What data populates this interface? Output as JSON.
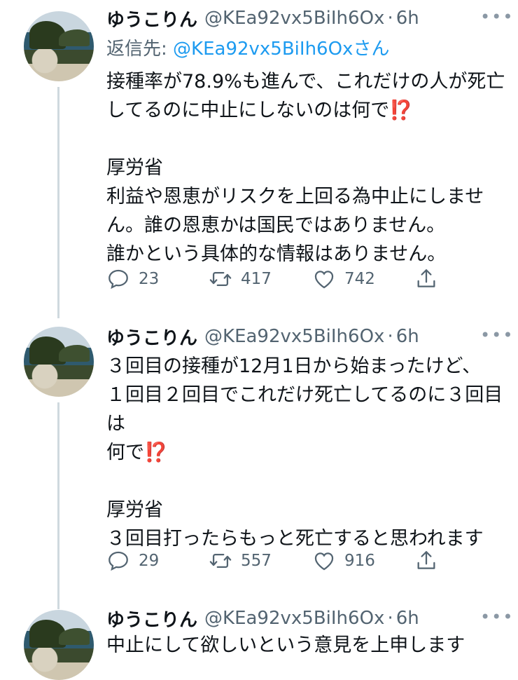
{
  "tweets": [
    {
      "name": "ゆうこりん",
      "handle": "@KEa92vx5BiIh6Ox",
      "dot": "·",
      "time": "6h",
      "reply_prefix": "返信先: ",
      "reply_mention": "@KEa92vx5BiIh6Oxさん",
      "text": "接種率が78.9%も進んで、これだけの人が死亡してるのに中止にしないのは何で⁉️\n\n厚労省\n利益や恩恵がリスクを上回る為中止にしません。誰の恩恵かは国民ではありません。\n誰かという具体的な情報はありません。",
      "replies": "23",
      "retweets": "417",
      "likes": "742"
    },
    {
      "name": "ゆうこりん",
      "handle": "@KEa92vx5BiIh6Ox",
      "dot": "·",
      "time": "6h",
      "text": "３回目の接種が12月1日から始まったけど、\n１回目２回目でこれだけ死亡してるのに３回目は\n何で⁉️\n\n厚労省\n３回目打ったらもっと死亡すると思われます",
      "replies": "29",
      "retweets": "557",
      "likes": "916"
    },
    {
      "name": "ゆうこりん",
      "handle": "@KEa92vx5BiIh6Ox",
      "dot": "·",
      "time": "6h",
      "text": "中止にして欲しいという意見を上申します"
    }
  ],
  "icons": {
    "more": "more-icon",
    "reply": "reply-icon",
    "retweet": "retweet-icon",
    "like": "heart-icon",
    "share": "share-icon"
  },
  "colors": {
    "text": "#0f1419",
    "secondary": "#536471",
    "link": "#1d9bf0",
    "thread_line": "#cfd9de"
  }
}
